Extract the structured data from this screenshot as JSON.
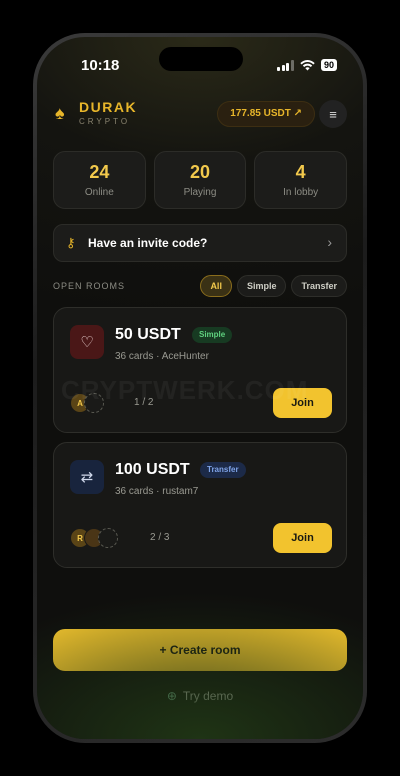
{
  "status": {
    "time": "10:18",
    "battery": "90"
  },
  "header": {
    "brand": "DURAK",
    "brand_sub": "CRYPTO",
    "balance": "177.85 USDT ↗"
  },
  "stats": [
    {
      "value": "24",
      "label": "Online"
    },
    {
      "value": "20",
      "label": "Playing"
    },
    {
      "value": "4",
      "label": "In lobby"
    }
  ],
  "invite": {
    "label": "Have an invite code?"
  },
  "rooms": {
    "title": "OPEN ROOMS",
    "filters": [
      "All",
      "Simple",
      "Transfer"
    ],
    "active_filter": "All",
    "items": [
      {
        "amount": "50 USDT",
        "type": "Simple",
        "meta": "36 cards · AceHunter",
        "avatars": [
          "A"
        ],
        "players": "1 / 2",
        "join_label": "Join",
        "icon": "heart-icon"
      },
      {
        "amount": "100 USDT",
        "type": "Transfer",
        "meta": "36 cards · rustam7",
        "avatars": [
          "R",
          ""
        ],
        "players": "2 / 3",
        "join_label": "Join",
        "icon": "transfer-arrows-icon"
      }
    ]
  },
  "actions": {
    "create": "+ Create room",
    "demo": "Try demo"
  },
  "watermark": "CRYPTWERK.COM",
  "colors": {
    "accent": "#f2c32e",
    "simple": "#5fd17f",
    "transfer": "#7ea3e8"
  }
}
